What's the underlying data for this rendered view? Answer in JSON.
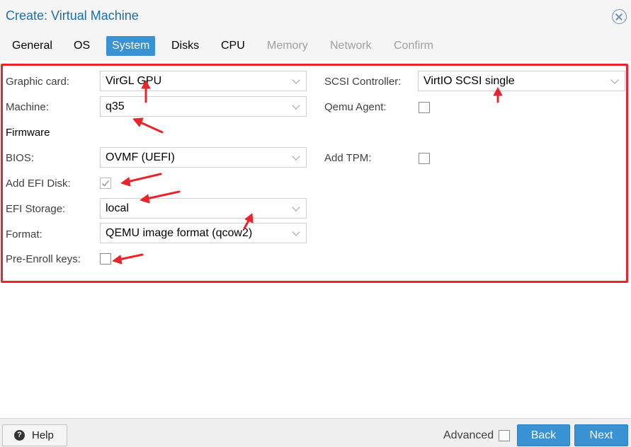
{
  "window": {
    "title": "Create: Virtual Machine"
  },
  "tabs": [
    {
      "label": "General",
      "state": "normal"
    },
    {
      "label": "OS",
      "state": "normal"
    },
    {
      "label": "System",
      "state": "active"
    },
    {
      "label": "Disks",
      "state": "normal"
    },
    {
      "label": "CPU",
      "state": "normal"
    },
    {
      "label": "Memory",
      "state": "disabled"
    },
    {
      "label": "Network",
      "state": "disabled"
    },
    {
      "label": "Confirm",
      "state": "disabled"
    }
  ],
  "form": {
    "graphic_card": {
      "label": "Graphic card:",
      "value": "VirGL GPU"
    },
    "machine": {
      "label": "Machine:",
      "value": "q35"
    },
    "firmware_heading": "Firmware",
    "bios": {
      "label": "BIOS:",
      "value": "OVMF (UEFI)"
    },
    "add_efi_disk": {
      "label": "Add EFI Disk:",
      "checked": true,
      "disabled": true
    },
    "efi_storage": {
      "label": "EFI Storage:",
      "value": "local"
    },
    "format": {
      "label": "Format:",
      "value": "QEMU image format (qcow2)"
    },
    "pre_enroll_keys": {
      "label": "Pre-Enroll keys:",
      "checked": false
    },
    "scsi_controller": {
      "label": "SCSI Controller:",
      "value": "VirtIO SCSI single"
    },
    "qemu_agent": {
      "label": "Qemu Agent:",
      "checked": false
    },
    "add_tpm": {
      "label": "Add TPM:",
      "checked": false
    }
  },
  "footer": {
    "help_label": "Help",
    "help_icon": "question-circle-icon",
    "advanced_label": "Advanced",
    "advanced_checked": false,
    "back_label": "Back",
    "next_label": "Next"
  },
  "colors": {
    "accent": "#3892d4",
    "title": "#1d6fa8",
    "annotation": "#e8252d"
  }
}
